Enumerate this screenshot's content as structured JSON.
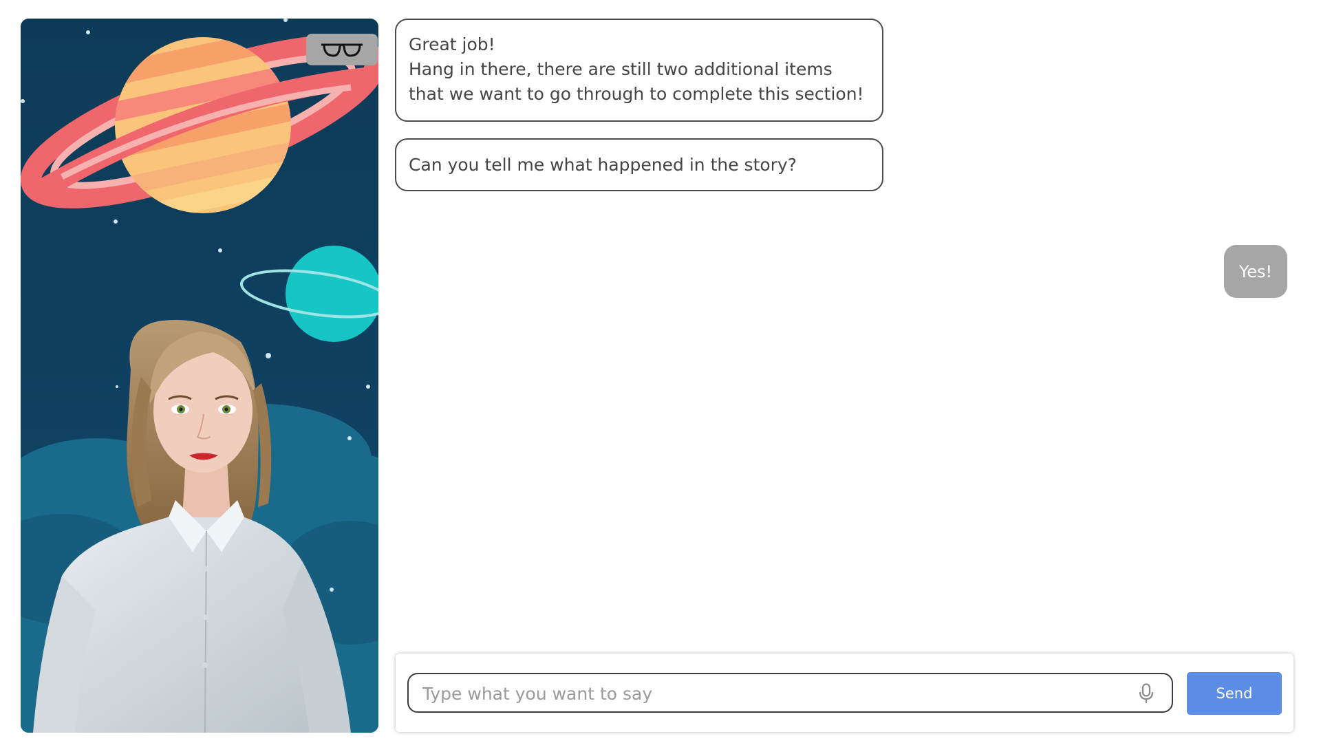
{
  "avatar": {
    "glasses_icon": "glasses-icon",
    "scene": "space-background-with-avatar"
  },
  "messages": [
    {
      "sender": "bot",
      "title": "Great job!",
      "text": "Hang in there, there are still two additional items that we want to go through to complete this section!"
    },
    {
      "sender": "bot",
      "text": "Can you tell me what happened in the story?"
    },
    {
      "sender": "user",
      "text": "Yes!"
    }
  ],
  "composer": {
    "placeholder": "Type what you want to say",
    "value": "",
    "mic_icon": "microphone-icon",
    "send_label": "Send"
  },
  "colors": {
    "send_button": "#5b8de5",
    "user_bubble": "#a6a6a6",
    "bot_bubble_border": "#4a4a4a",
    "scene_background": "#0f3b5b"
  }
}
